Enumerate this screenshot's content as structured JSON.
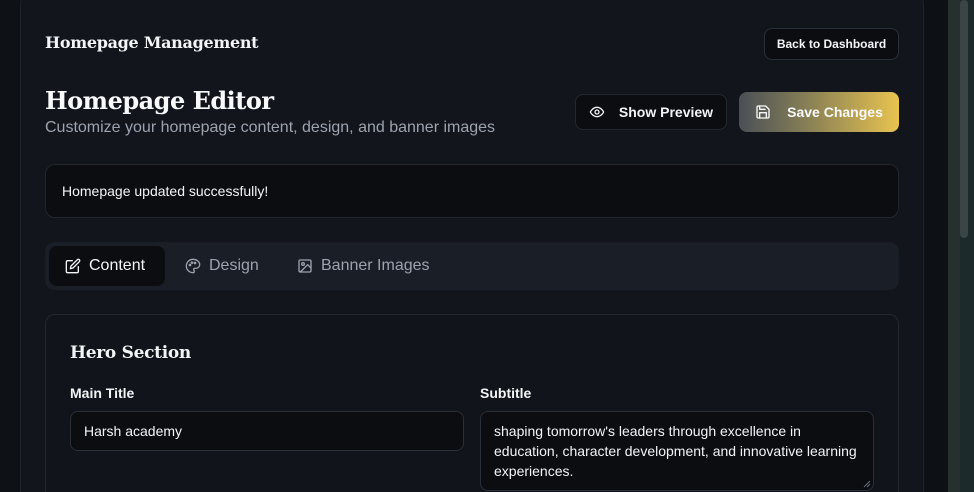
{
  "header": {
    "management_title": "Homepage Management",
    "back_button": "Back to Dashboard"
  },
  "editor": {
    "title": "Homepage Editor",
    "subtitle": "Customize your homepage content, design, and banner images",
    "preview_button": "Show Preview",
    "save_button": "Save Changes"
  },
  "alert": {
    "message": "Homepage updated successfully!"
  },
  "tabs": [
    {
      "label": "Content",
      "icon": "edit-icon",
      "active": true
    },
    {
      "label": "Design",
      "icon": "palette-icon",
      "active": false
    },
    {
      "label": "Banner Images",
      "icon": "image-icon",
      "active": false
    }
  ],
  "hero": {
    "section_title": "Hero Section",
    "main_title_label": "Main Title",
    "main_title_value": "Harsh academy",
    "subtitle_label": "Subtitle",
    "subtitle_value": "shaping tomorrow's leaders through excellence in education, character development, and innovative learning experiences."
  },
  "colors": {
    "background": "#0d1014",
    "panel": "#12161c",
    "accent_gold": "#e8c34f"
  }
}
